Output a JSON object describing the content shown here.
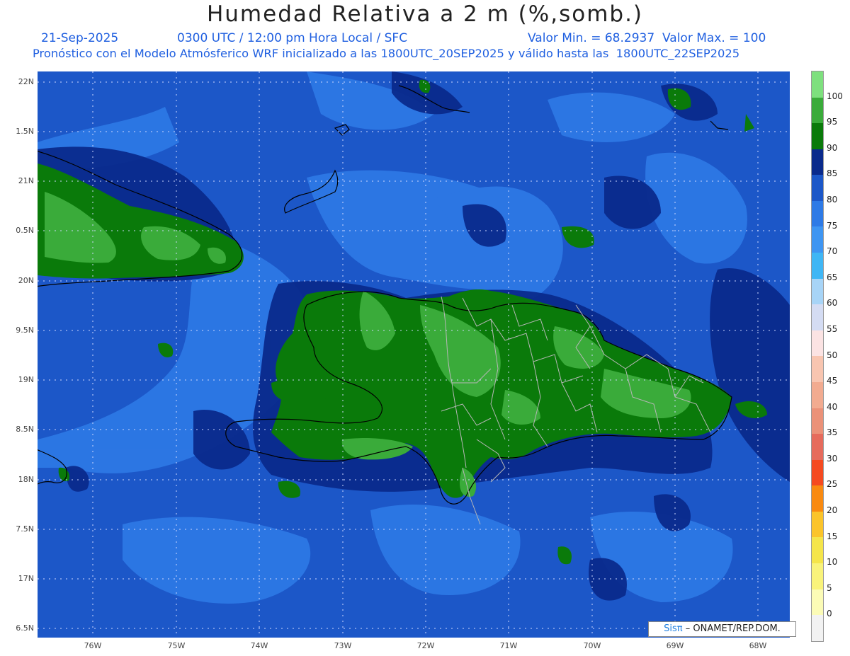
{
  "title": "Humedad Relativa a 2 m (%,somb.)",
  "subtitle": {
    "date": "21-Sep-2025",
    "time": "0300 UTC / 12:00 pm Hora Local / SFC",
    "stats": "Valor Min. = 68.2937  Valor Max. = 100",
    "model": "Pronóstico con el Modelo Atmósferico WRF inicializado a las 1800UTC_20SEP2025 y válido hasta las  1800UTC_22SEP2025"
  },
  "axes": {
    "lat_labels": [
      "22N",
      "1.5N",
      "21N",
      "0.5N",
      "20N",
      "9.5N",
      "19N",
      "8.5N",
      "18N",
      "7.5N",
      "17N",
      "6.5N"
    ],
    "lon_labels": [
      "76W",
      "75W",
      "74W",
      "73W",
      "72W",
      "71W",
      "70W",
      "69W",
      "68W"
    ]
  },
  "colorbar": {
    "labels": [
      "100",
      "95",
      "90",
      "85",
      "80",
      "75",
      "70",
      "65",
      "60",
      "55",
      "50",
      "45",
      "40",
      "35",
      "30",
      "25",
      "20",
      "15",
      "10",
      "5",
      "0"
    ],
    "colors": [
      "#7ee07e",
      "#3aab3a",
      "#0a7a0a",
      "#0a2a8c",
      "#1c57c8",
      "#2e7ae6",
      "#3e95f2",
      "#3fb6f5",
      "#a7d4f7",
      "#d4dcf3",
      "#fbe3e3",
      "#f8c5b0",
      "#f2ab90",
      "#eb9178",
      "#e66b5c",
      "#f54a20",
      "#f98a10",
      "#fbc42a",
      "#f5e54a",
      "#f9f37a",
      "#fbfbb6",
      "#f2f2f2"
    ]
  },
  "credit": {
    "brand": "Sisπ",
    "org": "– ONAMET/REP.DOM."
  }
}
